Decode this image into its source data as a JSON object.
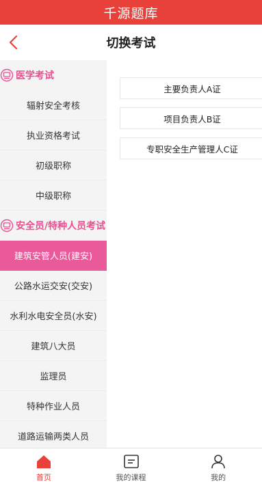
{
  "app": {
    "title": "千源题库"
  },
  "header": {
    "title": "切换考试",
    "back_icon": "chevron-left-icon"
  },
  "colors": {
    "brand": "#e8413a",
    "accent": "#ea5a9a",
    "category": "#ea4f8f"
  },
  "sidebar": {
    "sections": [
      {
        "title": "医学考试",
        "icon": "category-badge-icon",
        "items": [
          {
            "label": "辐射安全考核"
          },
          {
            "label": "执业资格考试"
          },
          {
            "label": "初级职称"
          },
          {
            "label": "中级职称"
          }
        ]
      },
      {
        "title": "安全员/特种人员考试",
        "icon": "category-badge-icon",
        "items": [
          {
            "label": "建筑安管人员(建安)"
          },
          {
            "label": "公路水运交安(交安)"
          },
          {
            "label": "水利水电安全员(水安)"
          },
          {
            "label": "建筑八大员"
          },
          {
            "label": "监理员"
          },
          {
            "label": "特种作业人员"
          },
          {
            "label": "道路运输两类人员"
          }
        ]
      }
    ],
    "active": "建筑安管人员(建安)"
  },
  "content": {
    "options": [
      {
        "label": "主要负责人A证"
      },
      {
        "label": "项目负责人B证"
      },
      {
        "label": "专职安全生产管理人C证"
      }
    ]
  },
  "tabbar": {
    "tabs": [
      {
        "label": "首页",
        "icon": "home-icon",
        "active": true
      },
      {
        "label": "我的课程",
        "icon": "course-icon",
        "active": false
      },
      {
        "label": "我的",
        "icon": "user-icon",
        "active": false
      }
    ]
  }
}
